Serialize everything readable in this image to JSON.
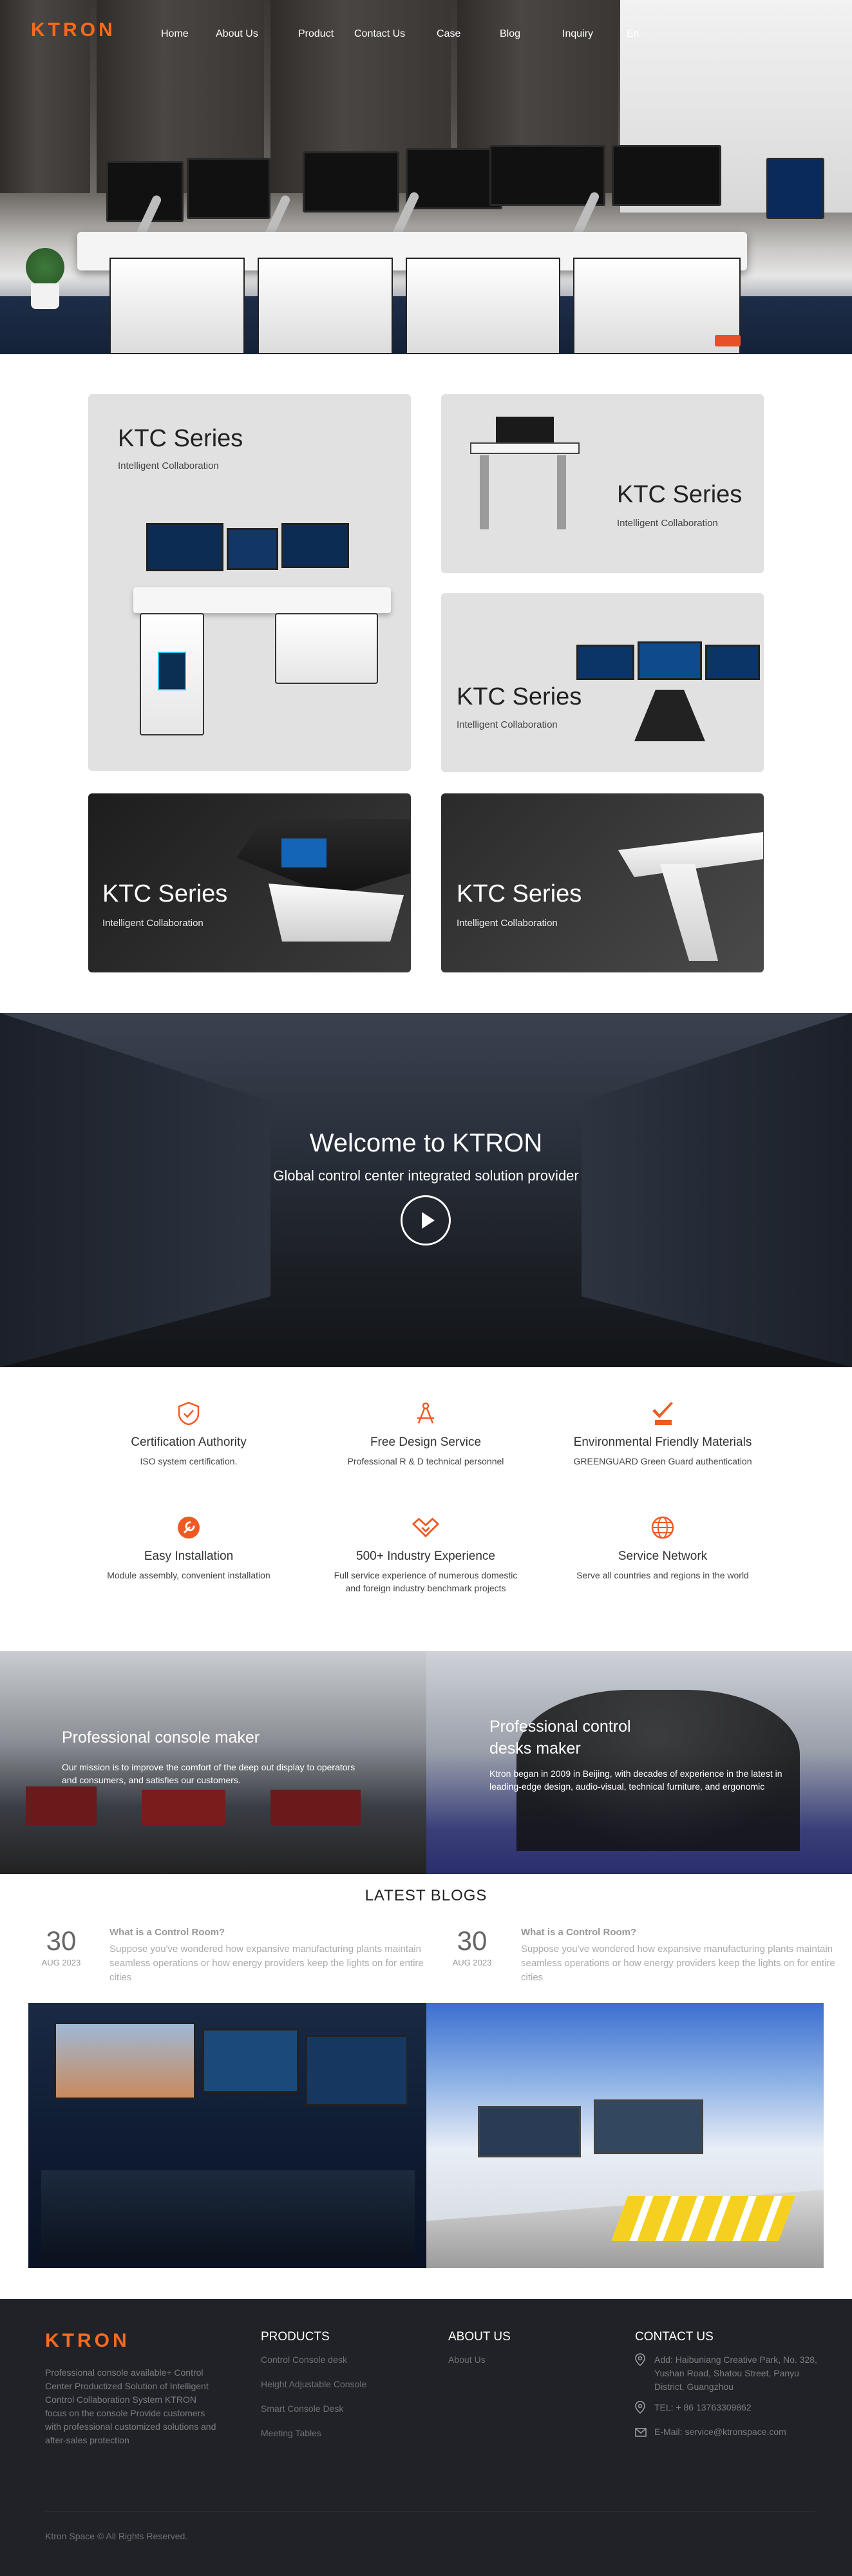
{
  "brand": {
    "logo": "KTRON",
    "accent": "#ff6a1a"
  },
  "nav": {
    "items": [
      {
        "label": "Home"
      },
      {
        "label": "About Us"
      },
      {
        "label": "Product"
      },
      {
        "label": "Contact Us"
      },
      {
        "label": "Case"
      },
      {
        "label": "Blog"
      },
      {
        "label": "Inquiry"
      },
      {
        "label": "En"
      }
    ]
  },
  "products": [
    {
      "title": "KTC Series",
      "subtitle": "Intelligent Collaboration"
    },
    {
      "title": "KTC Series",
      "subtitle": "Intelligent Collaboration"
    },
    {
      "title": "KTC Series",
      "subtitle": "Intelligent Collaboration"
    },
    {
      "title": "KTC Series",
      "subtitle": "Intelligent Collaboration"
    },
    {
      "title": "KTC Series",
      "subtitle": "Intelligent Collaboration"
    }
  ],
  "welcome": {
    "title": "Welcome to KTRON",
    "subtitle": "Global control center integrated solution provider"
  },
  "features": [
    {
      "icon": "shield-check-icon",
      "title": "Certification Authority",
      "desc": "ISO system certification."
    },
    {
      "icon": "design-compass-icon",
      "title": "Free Design Service",
      "desc": "Professional R & D technical personnel"
    },
    {
      "icon": "rohs-check-icon",
      "title": "Environmental Friendly Materials",
      "desc": "GREENGUARD Green Guard authentication"
    },
    {
      "icon": "wrench-icon",
      "title": "Easy Installation",
      "desc": "Module assembly, convenient installation"
    },
    {
      "icon": "handshake-icon",
      "title": "500+ Industry Experience",
      "desc": "Full service experience of numerous domestic and foreign industry benchmark projects"
    },
    {
      "icon": "globe-icon",
      "title": "Service Network",
      "desc": "Serve all countries and regions in the world"
    }
  ],
  "about": [
    {
      "title": "Professional console maker",
      "text": "Our mission is to improve the comfort of the deep out display to operators and consumers, and satisfies our customers."
    },
    {
      "title": "Professional control desks maker",
      "text": "Ktron began in 2009 in Beijing, with decades of experience in the latest in leading-edge design, audio-visual, technical furniture, and ergonomic"
    }
  ],
  "blogs": {
    "heading": "LATEST BLOGS",
    "posts": [
      {
        "day": "30",
        "month": "AUG 2023",
        "title": "What is a Control Room?",
        "excerpt": "Suppose you've wondered how expansive manufacturing plants maintain seamless operations or how energy providers keep the lights on for entire cities"
      },
      {
        "day": "30",
        "month": "AUG 2023",
        "title": "What is a Control Room?",
        "excerpt": "Suppose you've wondered how expansive manufacturing plants maintain seamless operations or how energy providers keep the lights on for entire cities"
      }
    ]
  },
  "footer": {
    "logo": "KTRON",
    "about": "Professional console available+ Control Center Productized Solution of Intelligent Control Collaboration System KTRON focus on the console Provide customers with professional customized solutions and after-sales protection",
    "products_heading": "PRODUCTS",
    "products": [
      "Control Console desk",
      "Height Adjustable Console",
      "Smart Console Desk",
      "Meeting Tables"
    ],
    "about_heading": "ABOUT US",
    "about_links": [
      "About Us"
    ],
    "contact_heading": "CONTACT US",
    "address": "Add: Haibuniang Creative Park, No. 328, Yushan Road, Shatou Street, Panyu District, Guangzhou",
    "tel": "TEL: + 86 13763309862",
    "email": "E-Mail: service@ktronspace.com",
    "copyright": "Ktron Space © All Rights Reserved."
  }
}
